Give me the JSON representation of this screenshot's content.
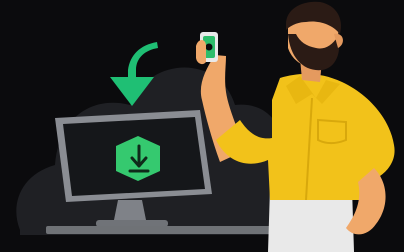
{
  "scene": {
    "background_color": "#0b0b0d",
    "cloud_color": "#1f2024",
    "arrow_color": "#1fbf74",
    "shield_color": "#35c96f",
    "shirt_color": "#f2c21a",
    "skin_color": "#f0a86a",
    "hair_color": "#2b1b15",
    "monitor_frame_color": "#8a8d93",
    "monitor_screen_color": "#15171a",
    "pants_color": "#e9e9e9",
    "icons": {
      "cloud": "cloud-icon",
      "download_arrow": "download-arrow-icon",
      "shield_download": "shield-download-icon",
      "phone": "phone-icon"
    }
  }
}
